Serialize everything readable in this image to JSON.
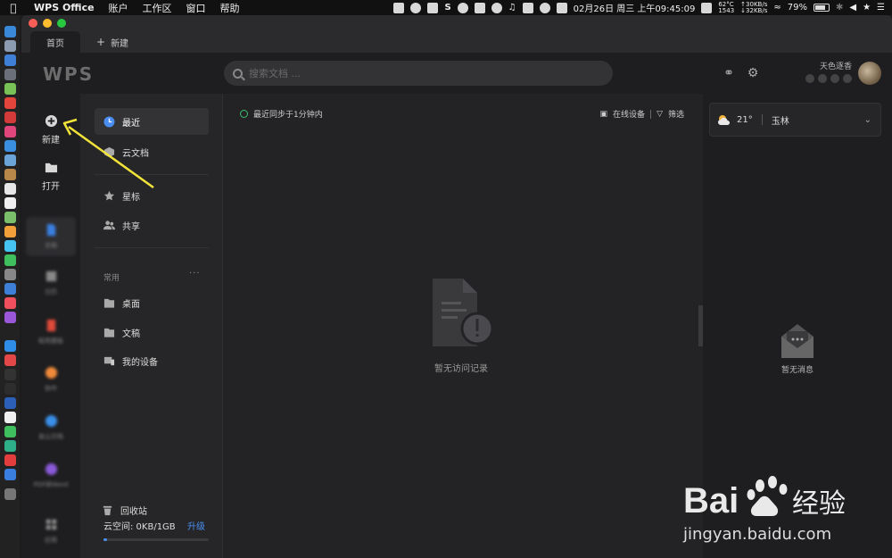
{
  "menubar": {
    "app_name": "WPS Office",
    "items": [
      "账户",
      "工作区",
      "窗口",
      "帮助"
    ],
    "date_time": "02月26日 周三 上午09:45:09",
    "temp_top": "62°C",
    "temp_bottom": "1543",
    "net_up": "↑30KB/s",
    "net_down": "↓32KB/s",
    "battery": "79%"
  },
  "tabs": {
    "home": "首页",
    "new_tab": "新建"
  },
  "header": {
    "logo": "WPS",
    "search_placeholder": "搜索文档 ...",
    "username": "天色逐香"
  },
  "leftnav": {
    "new": "新建",
    "open": "打开",
    "blurred": [
      "文档",
      "日历",
      "稻壳模板",
      "协作",
      "金山文档",
      "PDF转Word",
      "应用"
    ]
  },
  "sidebar": {
    "recent": "最近",
    "cloud_docs": "云文档",
    "starred": "星标",
    "shared": "共享",
    "section_common": "常用",
    "section_more": "···",
    "desktop": "桌面",
    "documents": "文稿",
    "my_device": "我的设备",
    "trash": "回收站",
    "storage_label": "云空间: 0KB/1GB",
    "upgrade": "升级"
  },
  "main": {
    "sync_status": "最近同步于1分钟内",
    "online_devices": "在线设备",
    "filter": "筛选",
    "empty_text": "暂无访问记录"
  },
  "rightpanel": {
    "temperature": "21°",
    "city": "玉林",
    "no_message": "暂无消息"
  },
  "watermark": {
    "brand_latin": "Bai",
    "brand_cn": "经验",
    "url": "jingyan.baidu.com"
  },
  "colors": {
    "accent": "#4a8df0",
    "arrow": "#f2e33a",
    "sync_green": "#3fbf6f"
  }
}
